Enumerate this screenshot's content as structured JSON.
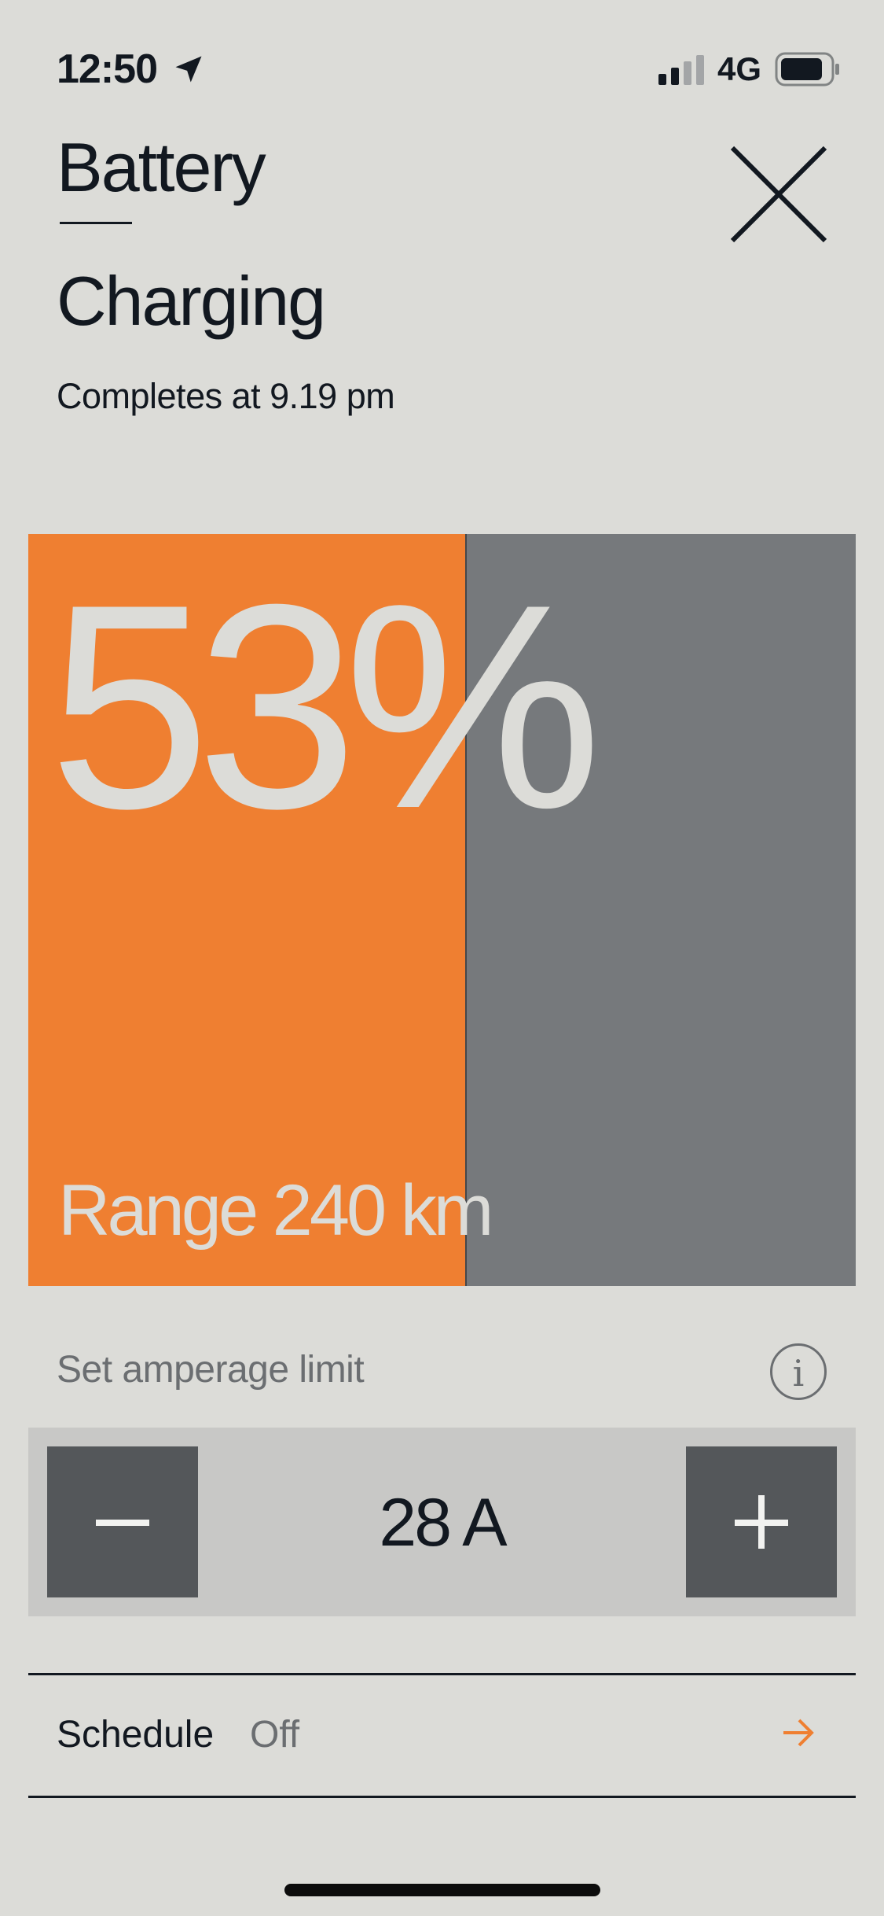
{
  "status_bar": {
    "time": "12:50",
    "network": "4G",
    "location_icon": "location-arrow-icon",
    "signal_icon": "cellular-signal-icon",
    "battery_icon": "battery-icon"
  },
  "header": {
    "title": "Battery",
    "subtitle": "Charging",
    "completion": "Completes at 9.19 pm",
    "close_icon": "close-icon"
  },
  "charge": {
    "percent_label": "53%",
    "level": 0.53,
    "range_label": "Range 240 km",
    "fill_color": "#ef7f31",
    "empty_color": "#76797c"
  },
  "amperage": {
    "label": "Set amperage limit",
    "info_icon": "info-icon",
    "value": "28 A",
    "decrease_icon": "minus-icon",
    "increase_icon": "plus-icon"
  },
  "schedule": {
    "label": "Schedule",
    "value": "Off",
    "arrow_icon": "arrow-right-icon",
    "accent_color": "#ef7f31"
  }
}
